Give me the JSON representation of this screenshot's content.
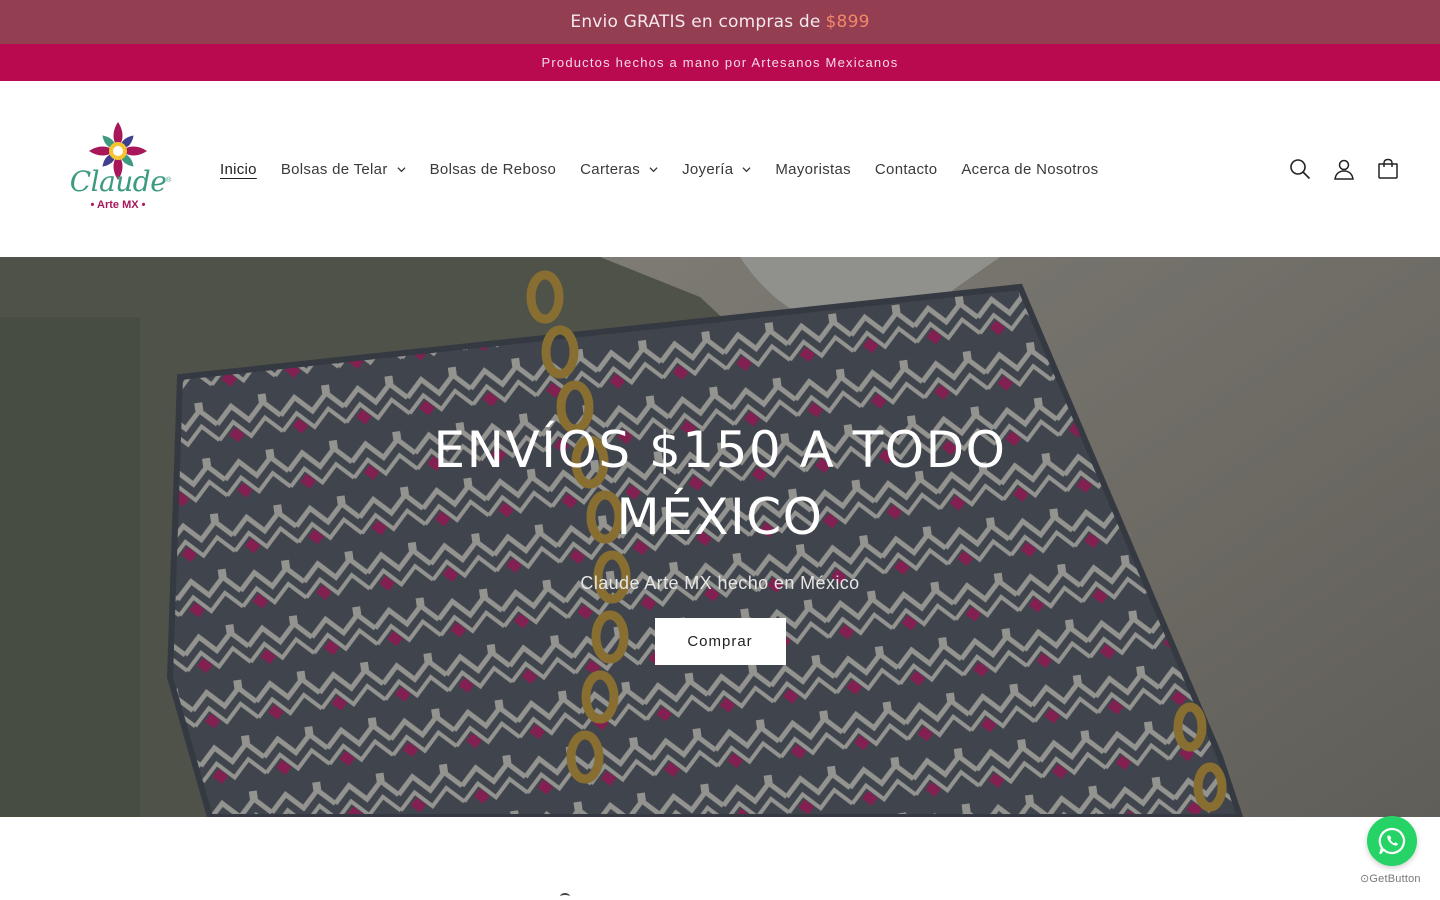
{
  "topbar": {
    "text": "Envio GRATIS en compras de",
    "price": "$899"
  },
  "announcement": {
    "text": "Productos hechos a mano por Artesanos Mexicanos"
  },
  "logo": {
    "brand": "Claude",
    "reg": "®",
    "sub": "• Arte MX •"
  },
  "nav": {
    "items": [
      {
        "label": "Inicio",
        "dropdown": false
      },
      {
        "label": "Bolsas de Telar",
        "dropdown": true
      },
      {
        "label": "Bolsas de Reboso",
        "dropdown": false
      },
      {
        "label": "Carteras",
        "dropdown": true
      },
      {
        "label": "Joyería",
        "dropdown": true
      },
      {
        "label": "Mayoristas",
        "dropdown": false
      },
      {
        "label": "Contacto",
        "dropdown": false
      },
      {
        "label": "Acerca de Nosotros",
        "dropdown": false
      }
    ]
  },
  "actions": {
    "icons": [
      "search-icon",
      "account-icon",
      "cart-icon"
    ]
  },
  "hero": {
    "title": "ENVÍOS $150 A TODO MÉXICO",
    "subtitle": "Claude Arte MX hecho en México",
    "button": "Comprar"
  },
  "whatsapp": {
    "caption": "GetButton"
  },
  "colors": {
    "topbar": "#943e52",
    "announcement": "#b9094f",
    "price": "#f2876b",
    "whatsapp": "#25d366"
  }
}
